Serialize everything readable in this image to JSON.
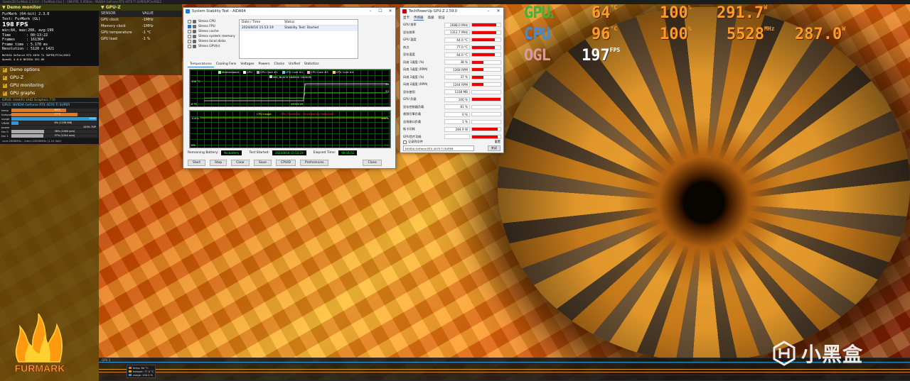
{
  "titlebar": "Geeks3D FurMark 2.3.0.0 - [ FurMark (GL) ] - 198 FPS, 5.050ms - NVIDIA GeForce RTX 4070 Ti SUPER/PCIe/SSE2",
  "left_panel": {
    "demo_monitor_title": "Demo monitor",
    "furmark_version": "FurMark (64-bit) 2.3.0",
    "test_name": "Test: FurMark (GL)",
    "fps": "198 FPS",
    "fps_stats": "min:84, max:208, avg:199",
    "info_rows": [
      {
        "k": "Time",
        "v": ": 00:13:22"
      },
      {
        "k": "Frames",
        "v": ": 161364"
      },
      {
        "k": "Frame time",
        "v": ": 5.170 ms"
      },
      {
        "k": "Resolution",
        "v": ": 5120 x 1421"
      }
    ],
    "renderer": "NVIDIA GeForce RTX 4070 Ti SUPER/PCIe/SSE2",
    "opengl": "OpenGL 4.6.0 NVIDIA 551.86",
    "checks": [
      "Demo options",
      "GPU-Z",
      "GPU monitoring",
      "GPU graphs"
    ],
    "gpu0_title": "GPU0: Intel(R) UHD Graphics 770",
    "gpu1_title": "GPU1: NVIDIA GeForce RTX 4070 Ti SUPER",
    "gpu_rows": [
      {
        "label": "temp",
        "value": "64°C",
        "fill": 0.64,
        "color": "#e07a20",
        "right": ""
      },
      {
        "label": "hotspot",
        "value": "77°C",
        "fill": 0.77,
        "color": "#e07a20",
        "right": ""
      },
      {
        "label": "usage",
        "value": "",
        "fill": 0.99,
        "color": "#2a9ad8",
        "right": "100%"
      },
      {
        "label": "VRAM",
        "value": "8% (1338 MB)",
        "fill": 0.08,
        "color": "#2a9ad8",
        "right": ""
      },
      {
        "label": "power",
        "value": "",
        "fill": 0.0,
        "color": "#2a9ad8",
        "right": "103% TDP"
      },
      {
        "label": "fan 0",
        "value": "38% (1268 rpm)",
        "fill": 0.38,
        "color": "#aaa",
        "right": ""
      },
      {
        "label": "fan 1",
        "value": "37% (1244 rpm)",
        "fill": 0.37,
        "color": "#aaa",
        "right": ""
      }
    ],
    "gpu_core": "core:2688MHz - mem:10500MHz (1.10 Volt)",
    "logo_text": "FURMARK"
  },
  "gpuz_panel": {
    "title": "GPU-Z",
    "col_sensor": "SENSOR",
    "col_value": "VALUE",
    "rows": [
      {
        "sensor": "GPU clock",
        "value": "-1MHz"
      },
      {
        "sensor": "Memory clock",
        "value": "-1MHz"
      },
      {
        "sensor": "GPU temperature",
        "value": "-1 °C"
      },
      {
        "sensor": "GPU load",
        "value": "-1 %"
      }
    ]
  },
  "hud": {
    "gpu": {
      "label": "GPU",
      "sub": "1",
      "temp": "64",
      "temp_unit": "°C",
      "load": "100",
      "load_unit": "%",
      "power": "291.7",
      "power_unit": "W",
      "color": "#3fb23f"
    },
    "cpu": {
      "label": "CPU",
      "temp": "96",
      "temp_unit": "°C",
      "load": "100",
      "load_unit": "%",
      "clock": "5528",
      "clock_unit": "MHz",
      "power": "287.0",
      "power_unit": "W",
      "color": "#3a8fe0"
    },
    "ogl": {
      "label": "OGL",
      "fps": "197",
      "fps_unit": "FPS",
      "color": "#d99a9a"
    }
  },
  "aida": {
    "title": "System Stability Test - AIDA64",
    "stress_items": [
      {
        "label": "Stress CPU",
        "checked": false
      },
      {
        "label": "Stress FPU",
        "checked": true
      },
      {
        "label": "Stress cache",
        "checked": false
      },
      {
        "label": "Stress system memory",
        "checked": false
      },
      {
        "label": "Stress local disks",
        "checked": false
      },
      {
        "label": "Stress GPU(s)",
        "checked": false
      }
    ],
    "status_header": {
      "date": "Date / Time",
      "status": "Status"
    },
    "status_row": {
      "date": "2024/8/16 15:53:19",
      "status": "Stability Test: Started"
    },
    "tabs": [
      "Temperatures",
      "Cooling Fans",
      "Voltages",
      "Powers",
      "Clocks",
      "Unified",
      "Statistics"
    ],
    "temp_legend": [
      "Motherboard",
      "CPU",
      "CPU Core #1",
      "CPU Core #2",
      "CPU Core #3",
      "CPU Core #4"
    ],
    "temp_legend2": "WD_BLACK SN850X 1000GB",
    "temp_top": "100 °C",
    "temp_bottom": "0 °C",
    "temp_time": "15:53:19",
    "temp_right_top": "96",
    "temp_right_bot": "52",
    "cpu_title": "CPU Usage",
    "cpu_title2": "CPU Throttling - Overheating Detected!",
    "cpu_top_left": "100%",
    "cpu_bot_left": "0%",
    "cpu_top_right": "100%",
    "cpu_bot_right": "0%",
    "remaining_battery_label": "Remaining Battery:",
    "remaining_battery": "No battery",
    "test_started_label": "Test Started:",
    "test_started": "2024/8/16 15:53:19",
    "elapsed_label": "Elapsed Time:",
    "elapsed": "00:11:52",
    "buttons": [
      "Start",
      "Stop",
      "Clear",
      "Save",
      "CPUID",
      "Preferences",
      "Close"
    ]
  },
  "gpuz_win": {
    "title": "TechPowerUp GPU-Z 2.59.0",
    "menu": [
      "显卡",
      "传感器",
      "高级",
      "验证"
    ],
    "rows": [
      {
        "name": "GPU 频率",
        "value": "2688.0 MHz",
        "fill": 0.85
      },
      {
        "name": "显存频率",
        "value": "1312.7 MHz",
        "fill": 0.85
      },
      {
        "name": "GPU 温度",
        "value": "64.0 °C",
        "fill": 0.8
      },
      {
        "name": "热点",
        "value": "77.0 °C",
        "fill": 0.8
      },
      {
        "name": "显存温度",
        "value": "64.0 °C",
        "fill": 0.8
      },
      {
        "name": "风扇 1速度 (%)",
        "value": "38 %",
        "fill": 0.4
      },
      {
        "name": "风扇 1速度 (RPM)",
        "value": "1268 RPM",
        "fill": 0.4
      },
      {
        "name": "风扇 2速度 (%)",
        "value": "37 %",
        "fill": 0.4
      },
      {
        "name": "风扇 2速度 (RPM)",
        "value": "1244 RPM",
        "fill": 0.4
      },
      {
        "name": "显存使用",
        "value": "1338 MB",
        "fill": 0.0
      },
      {
        "name": "GPU 负载",
        "value": "100 %",
        "fill": 1.0
      },
      {
        "name": "显存控制器负载",
        "value": "81 %",
        "fill": 0.0
      },
      {
        "name": "视频引擎负载",
        "value": "0 %",
        "fill": 0.0
      },
      {
        "name": "总线接口负载",
        "value": "1 %",
        "fill": 0.0
      },
      {
        "name": "板卡功耗",
        "value": "284.9 W",
        "fill": 0.9
      },
      {
        "name": "GPU芯片功耗",
        "value": "",
        "fill": 0.9
      }
    ],
    "log_label": "记录到文件",
    "reset": "重置",
    "close": "关闭",
    "device": "NVIDIA GeForce RTX 4070 Ti SUPER"
  },
  "strip": {
    "label": "GPU 1",
    "legend": [
      {
        "label": "temp: 64 °C",
        "color": "#e07a20"
      },
      {
        "label": "hotspot: 77.0 °C",
        "color": "#d0a020"
      },
      {
        "label": "usage: 100.0 %",
        "color": "#2a9ad8"
      }
    ]
  },
  "watermark": "小黑盒"
}
